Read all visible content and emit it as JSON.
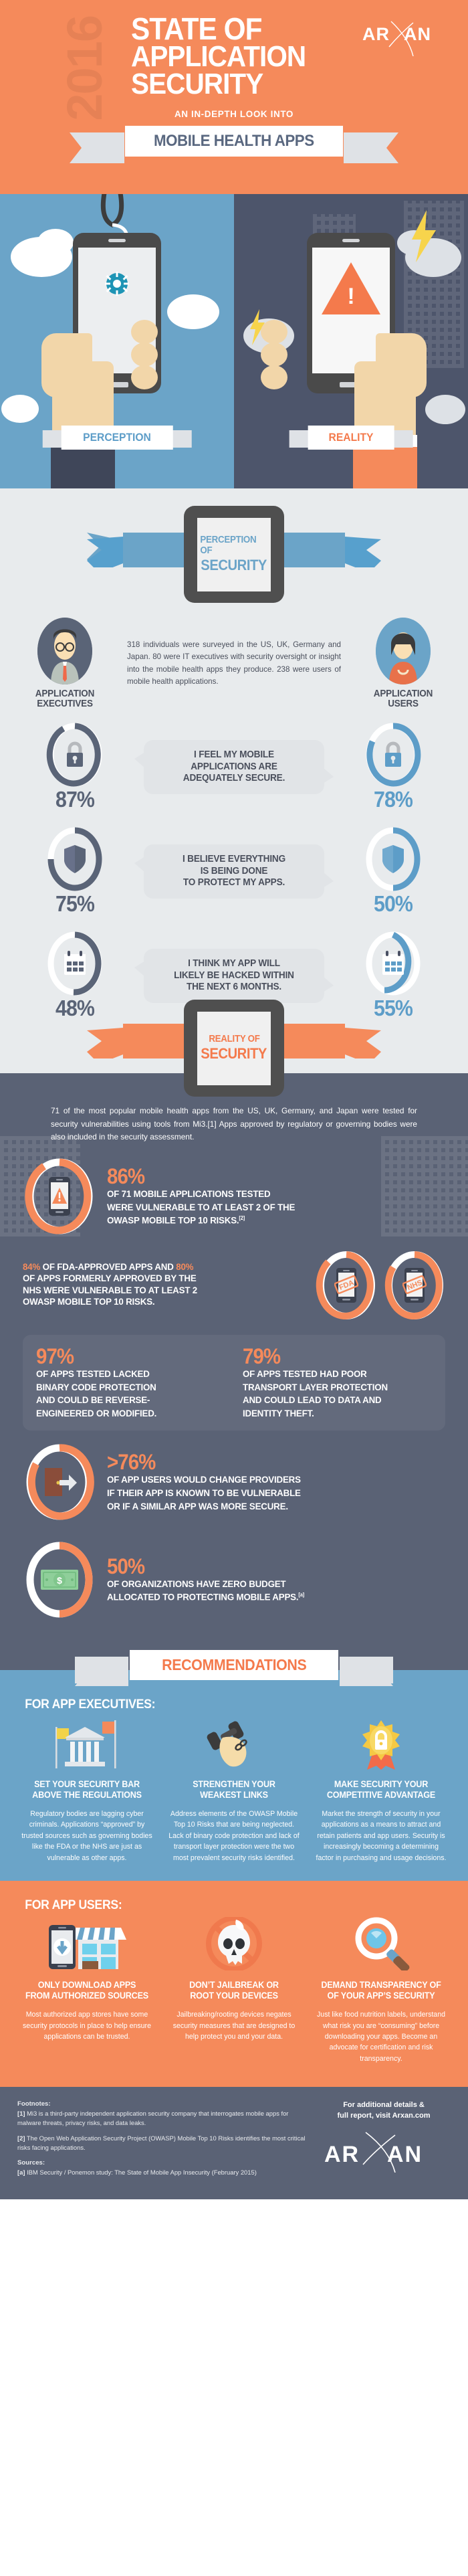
{
  "hero": {
    "year": "2016",
    "title_line1": "STATE OF",
    "title_line2": "APPLICATION",
    "title_line3": "SECURITY",
    "subtitle": "AN IN-DEPTH LOOK INTO",
    "ribbon": "MOBILE HEALTH APPS",
    "brand": "ARXAN"
  },
  "split": {
    "left_label": "PERCEPTION",
    "right_label": "REALITY"
  },
  "perception": {
    "tablet_line1": "PERCEPTION OF",
    "tablet_line2": "SECURITY",
    "persona_left": "APPLICATION\nEXECUTIVES",
    "persona_left_l1": "APPLICATION",
    "persona_left_l2": "EXECUTIVES",
    "persona_right_l1": "APPLICATION",
    "persona_right_l2": "USERS",
    "survey_text": "318 individuals were surveyed in the US, UK, Germany and Japan. 80 were IT executives with security oversight or insight into the mobile health apps they produce. 238 were users of mobile health applications.",
    "stats": [
      {
        "icon": "lock-icon",
        "left_pct": "87%",
        "right_pct": "78%",
        "left_value": 87,
        "right_value": 78,
        "statement_l1": "I FEEL MY MOBILE",
        "statement_l2": "APPLICATIONS ARE",
        "statement_l3": "ADEQUATELY SECURE."
      },
      {
        "icon": "shield-icon",
        "left_pct": "75%",
        "right_pct": "50%",
        "left_value": 75,
        "right_value": 50,
        "statement_l1": "I BELIEVE EVERYTHING",
        "statement_l2": "IS BEING DONE",
        "statement_l3": "TO PROTECT MY APPS."
      },
      {
        "icon": "calendar-icon",
        "left_pct": "48%",
        "right_pct": "55%",
        "left_value": 48,
        "right_value": 55,
        "statement_l1": "I THINK MY APP WILL",
        "statement_l2": "LIKELY BE HACKED WITHIN",
        "statement_l3": "THE NEXT 6 MONTHS."
      }
    ]
  },
  "reality": {
    "tablet_line1": "REALITY OF",
    "tablet_line2": "SECURITY",
    "intro": "71 of the most popular mobile health apps from the US, UK, Germany, and Japan were tested for security vulnerabilities using tools from Mi3.[1] Apps approved by regulatory or governing bodies were also included in the security assessment.",
    "stat_86": {
      "pct": "86%",
      "value": 86,
      "line1": "OF 71 MOBILE APPLICATIONS TESTED",
      "line2": "WERE VULNERABLE TO AT LEAST 2 OF THE",
      "line3": "OWASP MOBILE TOP 10 RISKS.",
      "ref": "[2]",
      "icon": "phone-warning-icon"
    },
    "fda": {
      "pct_fda": "84%",
      "pct_nhs": "80%",
      "value_fda": 84,
      "value_nhs": 80,
      "text_a": " OF FDA-APPROVED APPS AND ",
      "text_b": "OF APPS FORMERLY APPROVED BY THE",
      "text_c": "NHS WERE VULNERABLE TO AT LEAST 2",
      "text_d": "OWASP MOBILE TOP 10 RISKS.",
      "badge_fda": "FDA",
      "badge_nhs": "NHS"
    },
    "twin": [
      {
        "pct": "97%",
        "line1": "OF APPS TESTED LACKED",
        "line2": "BINARY CODE PROTECTION",
        "line3": "AND COULD BE REVERSE-",
        "line4": "ENGINEERED OR MODIFIED."
      },
      {
        "pct": "79%",
        "line1": "OF APPS TESTED HAD POOR",
        "line2": "TRANSPORT LAYER PROTECTION",
        "line3": "AND COULD LEAD TO DATA AND",
        "line4": "IDENTITY THEFT."
      }
    ],
    "stat_76": {
      "pct": ">76%",
      "value": 76,
      "line1": "OF APP USERS WOULD CHANGE PROVIDERS",
      "line2": "IF THEIR APP IS KNOWN TO BE VULNERABLE",
      "line3": "OR IF A SIMILAR APP WAS MORE SECURE.",
      "icon": "exit-door-icon"
    },
    "stat_50": {
      "pct": "50%",
      "value": 50,
      "line1": "OF ORGANIZATIONS HAVE ZERO BUDGET",
      "line2": "ALLOCATED TO PROTECTING MOBILE APPS.",
      "ref": "[a]",
      "icon": "money-icon"
    }
  },
  "recommendations": {
    "ribbon": "RECOMMENDATIONS",
    "exec_heading": "FOR APP EXECUTIVES:",
    "exec_cards": [
      {
        "icon": "government-building-icon",
        "title_l1": "SET YOUR SECURITY BAR",
        "title_l2": "ABOVE THE REGULATIONS",
        "body": "Regulatory bodies are lagging cyber criminals. Applications “approved” by trusted sources such as governing bodies like the FDA or the NHS are just as vulnerable as other apps."
      },
      {
        "icon": "strong-arm-icon",
        "title_l1": "STRENGTHEN YOUR",
        "title_l2": "WEAKEST LINKS",
        "body": "Address elements of the OWASP Mobile Top 10 Risks that are being neglected. Lack of binary code protection and lack of transport layer protection were the two most prevalent security risks identified."
      },
      {
        "icon": "award-badge-icon",
        "title_l1": "MAKE SECURITY YOUR",
        "title_l2": "COMPETITIVE ADVANTAGE",
        "body": "Market the strength of security in your applications as a means to attract and retain patients and app users. Security is increasingly becoming a determining factor in purchasing and usage decisions."
      }
    ],
    "users_heading": "FOR APP USERS:",
    "user_cards": [
      {
        "icon": "app-store-download-icon",
        "title_l1": "ONLY DOWNLOAD APPS",
        "title_l2": "FROM AUTHORIZED SOURCES",
        "body": "Most authorized app stores have some security protocols in place to help ensure applications can be trusted."
      },
      {
        "icon": "no-jailbreak-skull-icon",
        "title_l1": "DON’T JAILBREAK OR",
        "title_l2": "ROOT YOUR DEVICES",
        "body": "Jailbreaking/rooting devices negates security measures that are designed to help protect you and your data."
      },
      {
        "icon": "magnifying-glass-icon",
        "title_l1": "DEMAND TRANSPARENCY OF",
        "title_l2": "OF YOUR APP’S SECURITY",
        "body": "Just like food nutrition labels, understand what risk you are “consuming” before downloading your apps. Become an advocate for certification and risk transparency."
      }
    ]
  },
  "footer": {
    "footnotes_heading": "Footnotes:",
    "fn1_marker": "[1]",
    "fn1_text": " Mi3 is a third-party independent application security company that interrogates mobile apps for malware threats, privacy risks, and data leaks.",
    "fn2_marker": "[2]",
    "fn2_text": " The Open Web Application Security Project (OWASP) Mobile Top 10 Risks identifies the most critical risks facing applications.",
    "sources_heading": "Sources:",
    "src_marker": "[a]",
    "src_text": " IBM Security / Ponemon study: The State of Mobile App Insecurity (February 2015)",
    "cta_l1": "For additional details &",
    "cta_l2": "full report, visit Arxan.com",
    "brand": "ARXAN"
  },
  "colors": {
    "orange": "#f58a5b",
    "orange_dark": "#f47a4c",
    "blue": "#6ba4c8",
    "blue_dark": "#5d9dc8",
    "slate": "#5a6275",
    "slate_dark": "#4d556b",
    "light": "#e8ebed"
  }
}
